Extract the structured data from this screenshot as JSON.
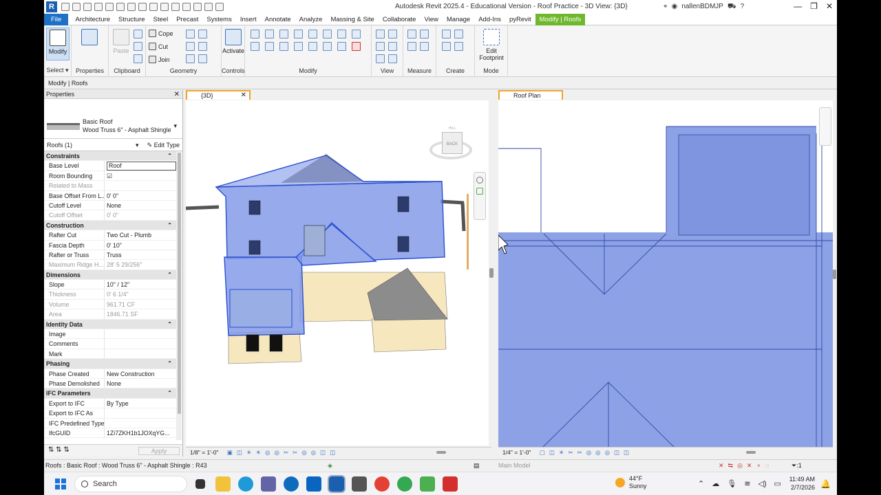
{
  "app": {
    "title": "Autodesk Revit 2025.4 - Educational Version - Roof Practice - 3D View: {3D}",
    "logo": "R",
    "user": "nallenBDMJP",
    "help": "?"
  },
  "ribbon_tabs": [
    "File",
    "Architecture",
    "Structure",
    "Steel",
    "Precast",
    "Systems",
    "Insert",
    "Annotate",
    "Analyze",
    "Massing & Site",
    "Collaborate",
    "View",
    "Manage",
    "Add-Ins",
    "pyRevit",
    "Modify | Roofs"
  ],
  "ribbon": {
    "select": {
      "modify": "Modify",
      "label": "Select ▾"
    },
    "properties": {
      "label": "Properties"
    },
    "clipboard": {
      "paste": "Paste",
      "label": "Clipboard"
    },
    "geometry": {
      "cope": "Cope",
      "cut": "Cut",
      "join": "Join",
      "label": "Geometry"
    },
    "controls": {
      "activate": "Activate",
      "label": "Controls"
    },
    "modify": {
      "label": "Modify"
    },
    "view": {
      "label": "View"
    },
    "measure": {
      "label": "Measure"
    },
    "create": {
      "label": "Create"
    },
    "mode": {
      "edit_line1": "Edit",
      "edit_line2": "Footprint",
      "label": "Mode"
    }
  },
  "context_bar": "Modify | Roofs",
  "properties": {
    "title": "Properties",
    "type_line1": "Basic Roof",
    "type_line2": "Wood Truss 6\" - Asphalt Shingle",
    "instance": "Roofs (1)",
    "edit_type": "Edit Type",
    "apply": "Apply",
    "rows": [
      {
        "group": "Constraints"
      },
      {
        "name": "Base Level",
        "value": "Roof",
        "input": true
      },
      {
        "name": "Room Bounding",
        "value": "☑"
      },
      {
        "name": "Related to Mass",
        "value": "",
        "disabled": true
      },
      {
        "name": "Base Offset From L...",
        "value": "0'  0\""
      },
      {
        "name": "Cutoff Level",
        "value": "None"
      },
      {
        "name": "Cutoff Offset",
        "value": "0'  0\"",
        "disabled": true
      },
      {
        "group": "Construction"
      },
      {
        "name": "Rafter Cut",
        "value": "Two Cut - Plumb"
      },
      {
        "name": "Fascia Depth",
        "value": "0'  10\""
      },
      {
        "name": "Rafter or Truss",
        "value": "Truss"
      },
      {
        "name": "Maximum Ridge H...",
        "value": "28'  5 29/256\"",
        "disabled": true
      },
      {
        "group": "Dimensions"
      },
      {
        "name": "Slope",
        "value": "10\" / 12\""
      },
      {
        "name": "Thickness",
        "value": "0'  6 1/4\"",
        "disabled": true
      },
      {
        "name": "Volume",
        "value": "961.71 CF",
        "disabled": true
      },
      {
        "name": "Area",
        "value": "1846.71 SF",
        "disabled": true
      },
      {
        "group": "Identity Data"
      },
      {
        "name": "Image",
        "value": ""
      },
      {
        "name": "Comments",
        "value": ""
      },
      {
        "name": "Mark",
        "value": ""
      },
      {
        "group": "Phasing"
      },
      {
        "name": "Phase Created",
        "value": "New Construction"
      },
      {
        "name": "Phase Demolished",
        "value": "None"
      },
      {
        "group": "IFC Parameters"
      },
      {
        "name": "Export to IFC",
        "value": "By Type"
      },
      {
        "name": "Export to IFC As",
        "value": ""
      },
      {
        "name": "IFC Predefined Type",
        "value": ""
      },
      {
        "name": "IfcGUID",
        "value": "1Zi7ZKH1b1JOXqYG..."
      }
    ]
  },
  "views": {
    "view3d": {
      "tab": "{3D}",
      "scale": "1/8\" = 1'-0\"",
      "viewcube": "BACK",
      "viewcube_top": "HILL"
    },
    "plan": {
      "tab": "Roof Plan",
      "scale": "1/4\" = 1'-0\""
    }
  },
  "status": {
    "text": "Roofs : Basic Roof : Wood Truss 6\" - Asphalt Shingle : R43",
    "model": "Main Model",
    "filter": ":1"
  },
  "taskbar": {
    "search": "Search",
    "temp": "44°F",
    "weather": "Sunny",
    "time": "11:49 AM",
    "date": "2/7/2026"
  },
  "colors": {
    "roof_selected": "#7f97e8",
    "accent": "#1f71c6",
    "context_tab": "#6fb82d",
    "view_tab": "#f0a12a"
  }
}
